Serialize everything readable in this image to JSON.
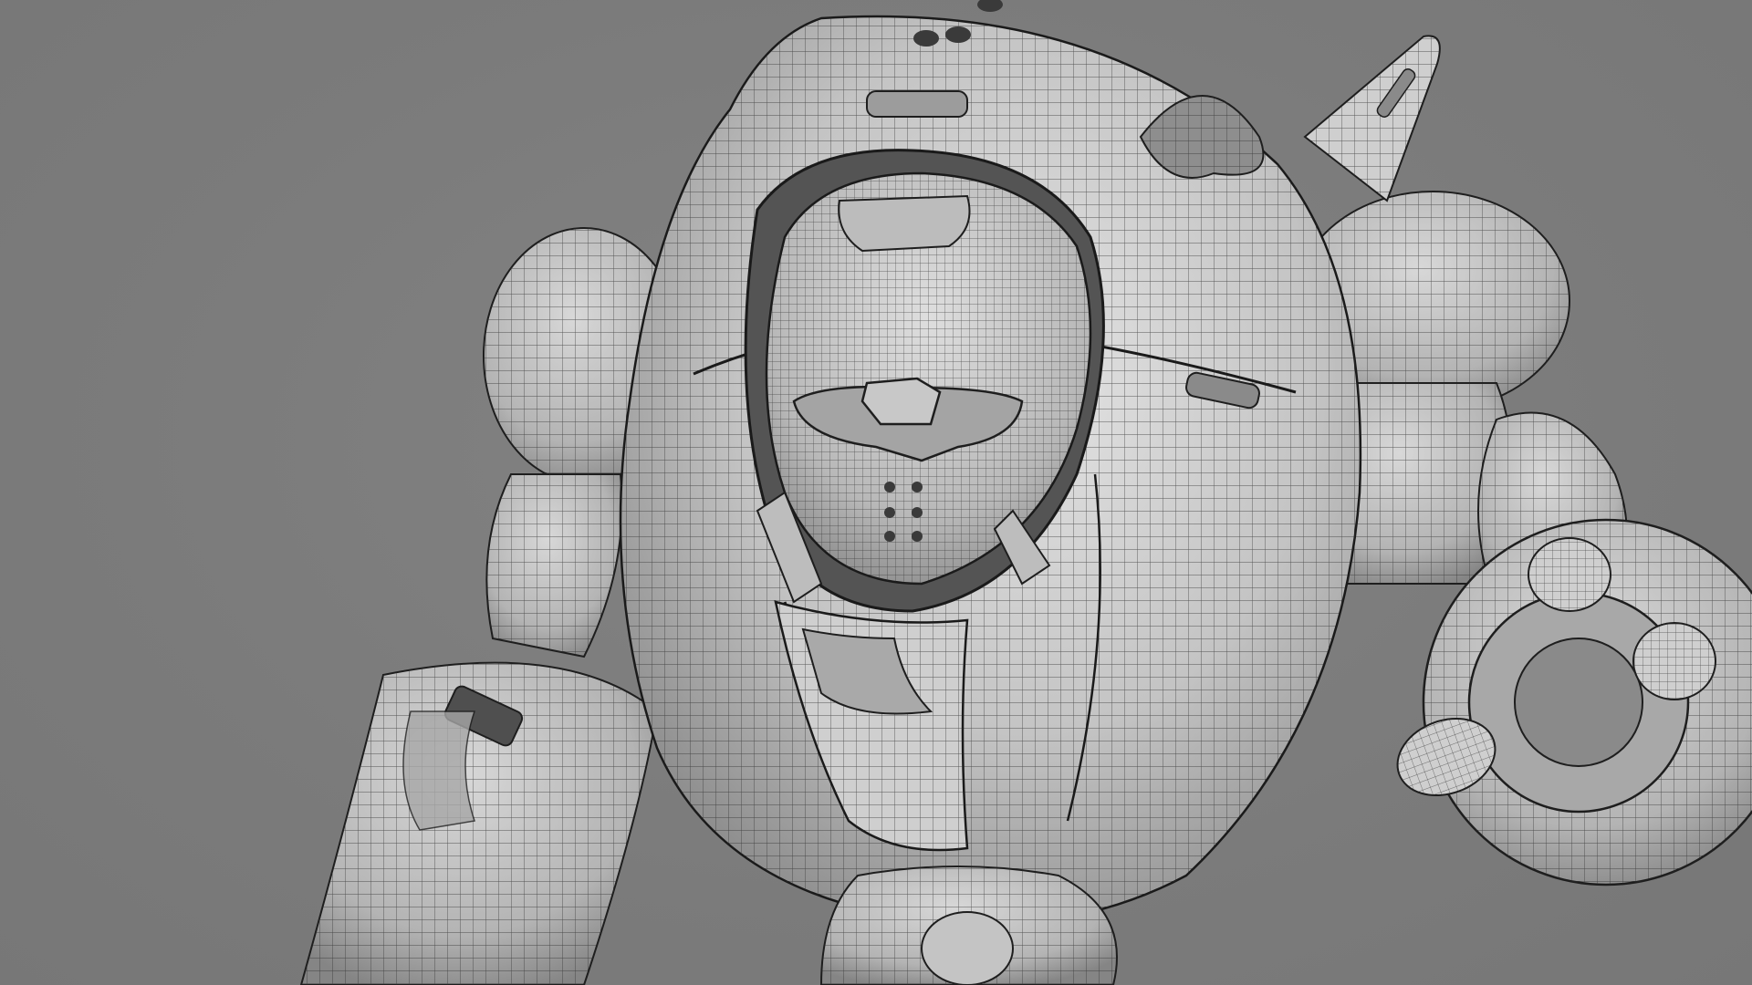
{
  "viewport": {
    "background_color": "#7d7d7d",
    "subject": "wireframe-robot-model",
    "render_mode": "shaded-wireframe"
  },
  "colors": {
    "surface_light": "#d9d9d9",
    "surface_mid": "#bdbdbd",
    "surface_dark": "#8e8e8e",
    "wire": "#2a2a2a",
    "cavity": "#4a4a4a"
  }
}
